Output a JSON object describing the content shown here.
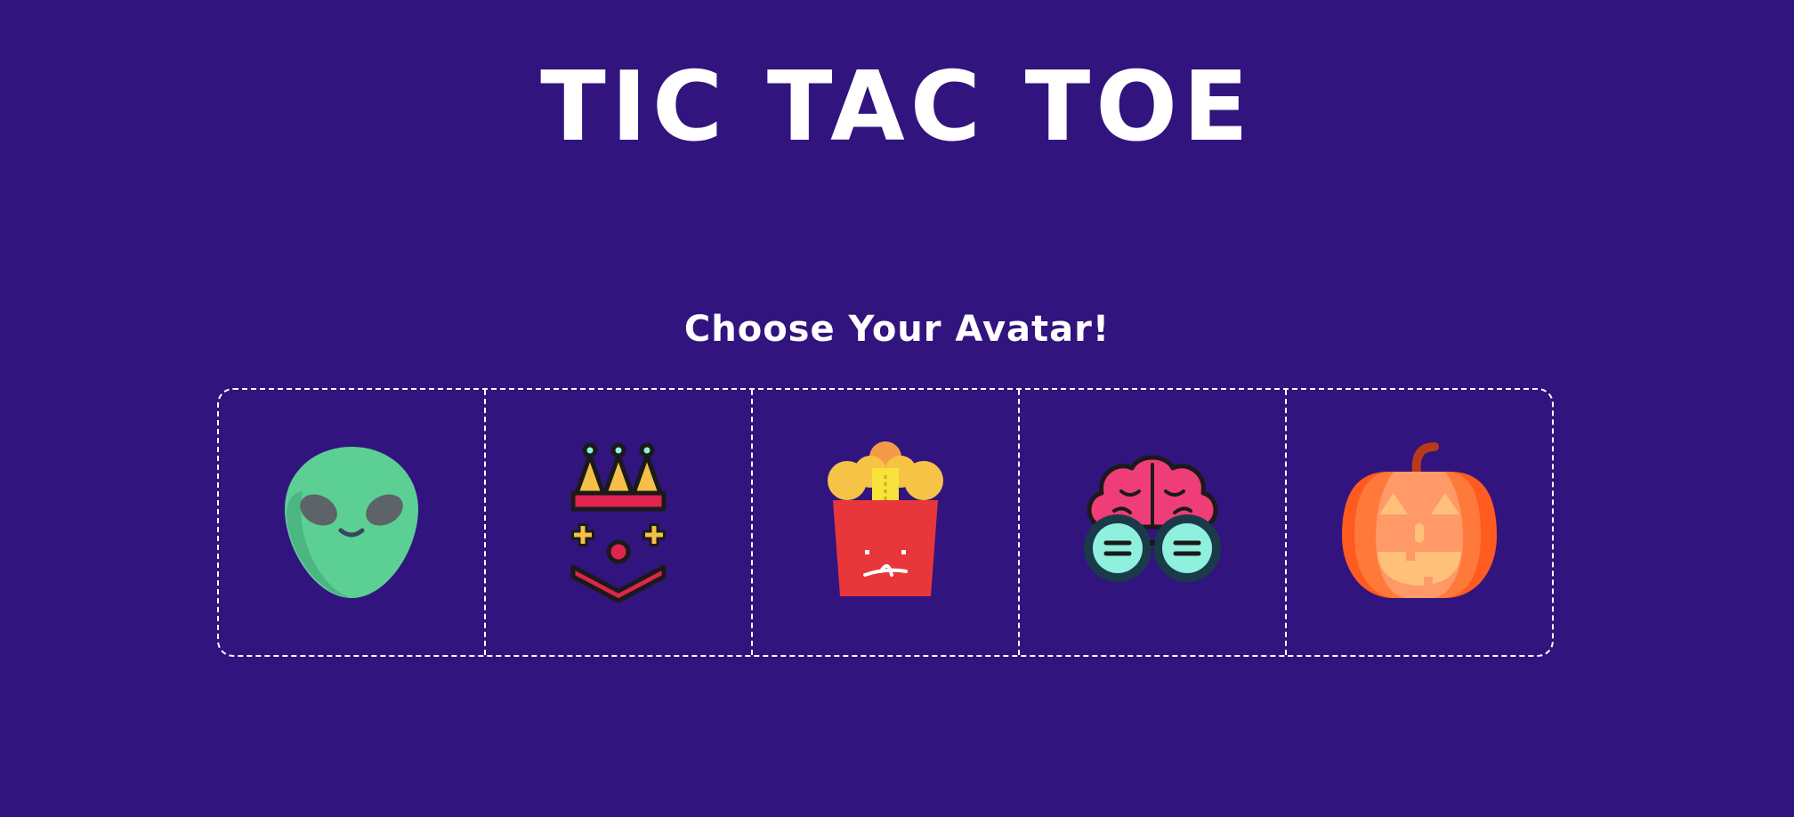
{
  "title": "TIC TAC TOE",
  "subtitle": "Choose Your Avatar!",
  "avatars": [
    {
      "name": "alien",
      "icon": "alien-icon"
    },
    {
      "name": "clown",
      "icon": "clown-icon"
    },
    {
      "name": "fries",
      "icon": "fries-icon"
    },
    {
      "name": "brain",
      "icon": "brain-with-glasses-icon"
    },
    {
      "name": "pumpkin",
      "icon": "pumpkin-icon"
    }
  ],
  "colors": {
    "background": "#32147e",
    "text": "#ffffff",
    "alien": "#5ccf94",
    "clown_red": "#e0244f",
    "clown_yellow": "#f6bf48",
    "fries_box": "#e8373a",
    "fries": "#f8ce3a",
    "brain": "#ef3d78",
    "glasses": "#8ff0dd",
    "pumpkin": "#ff7a3a"
  }
}
